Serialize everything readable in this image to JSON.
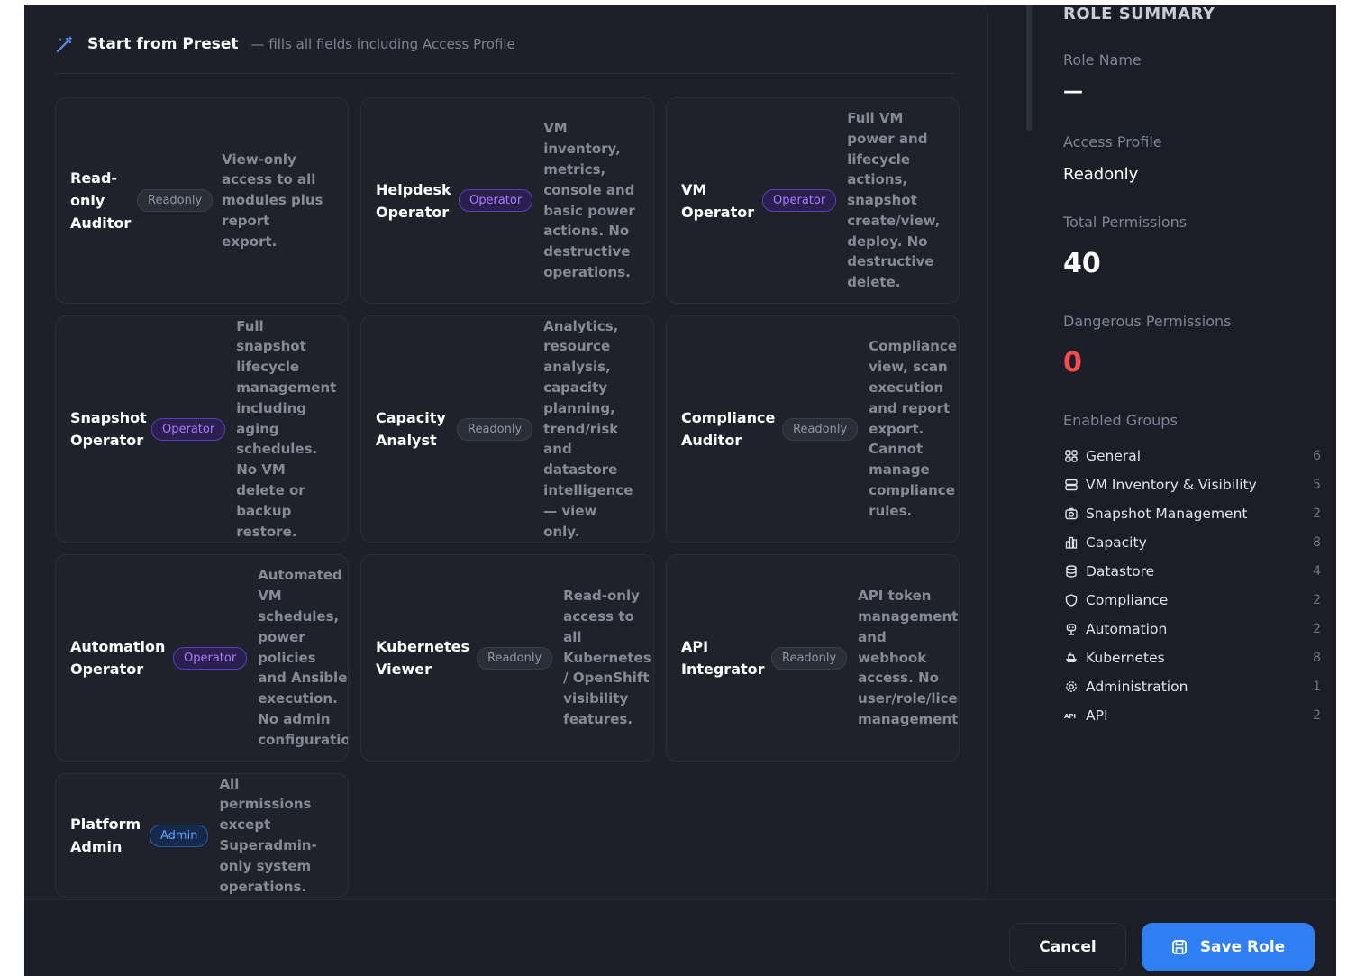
{
  "preset_header": {
    "title": "Start from Preset",
    "subtitle": "— fills all fields including Access Profile"
  },
  "presets": [
    {
      "name": "Read-only Auditor",
      "badge": "Readonly",
      "description": "View-only access to all modules plus report export."
    },
    {
      "name": "Helpdesk Operator",
      "badge": "Operator",
      "description": "VM inventory, metrics, console and basic power actions. No destructive operations."
    },
    {
      "name": "VM Operator",
      "badge": "Operator",
      "description": "Full VM power and lifecycle actions, snapshot create/view, deploy. No destructive delete."
    },
    {
      "name": "Snapshot Operator",
      "badge": "Operator",
      "description": "Full snapshot lifecycle management including aging schedules. No VM delete or backup restore."
    },
    {
      "name": "Capacity Analyst",
      "badge": "Readonly",
      "description": "Analytics, resource analysis, capacity planning, trend/risk and datastore intelligence — view only."
    },
    {
      "name": "Compliance Auditor",
      "badge": "Readonly",
      "description": "Compliance view, scan execution and report export. Cannot manage compliance rules."
    },
    {
      "name": "Automation Operator",
      "badge": "Operator",
      "description": "Automated VM schedules, power policies and Ansible execution. No admin configuration."
    },
    {
      "name": "Kubernetes Viewer",
      "badge": "Readonly",
      "description": "Read-only access to all Kubernetes / OpenShift visibility features."
    },
    {
      "name": "API Integrator",
      "badge": "Readonly",
      "description": "API token management and webhook access. No user/role/license management."
    },
    {
      "name": "Platform Admin",
      "badge": "Admin",
      "description": "All permissions except Superadmin-only system operations."
    }
  ],
  "summary": {
    "title": "ROLE SUMMARY",
    "role_name_label": "Role Name",
    "role_name_value": "—",
    "access_profile_label": "Access Profile",
    "access_profile_value": "Readonly",
    "total_label": "Total Permissions",
    "total_value": "40",
    "dangerous_label": "Dangerous Permissions",
    "dangerous_value": "0",
    "groups_label": "Enabled Groups",
    "groups": [
      {
        "label": "General",
        "count": "6",
        "icon": "grid-icon"
      },
      {
        "label": "VM Inventory & Visibility",
        "count": "5",
        "icon": "server-icon"
      },
      {
        "label": "Snapshot Management",
        "count": "2",
        "icon": "camera-icon"
      },
      {
        "label": "Capacity",
        "count": "8",
        "icon": "bar-chart-icon"
      },
      {
        "label": "Datastore",
        "count": "4",
        "icon": "database-icon"
      },
      {
        "label": "Compliance",
        "count": "2",
        "icon": "shield-icon"
      },
      {
        "label": "Automation",
        "count": "2",
        "icon": "robot-icon"
      },
      {
        "label": "Kubernetes",
        "count": "8",
        "icon": "ship-icon"
      },
      {
        "label": "Administration",
        "count": "1",
        "icon": "gear-icon"
      },
      {
        "label": "API",
        "count": "2",
        "icon": "api-icon"
      }
    ]
  },
  "footer": {
    "cancel_label": "Cancel",
    "save_label": "Save Role"
  },
  "colors": {
    "accent": "#2f7ff2",
    "danger": "#ff4d4f",
    "operator": "#a87bff",
    "admin": "#5aa2ff"
  }
}
